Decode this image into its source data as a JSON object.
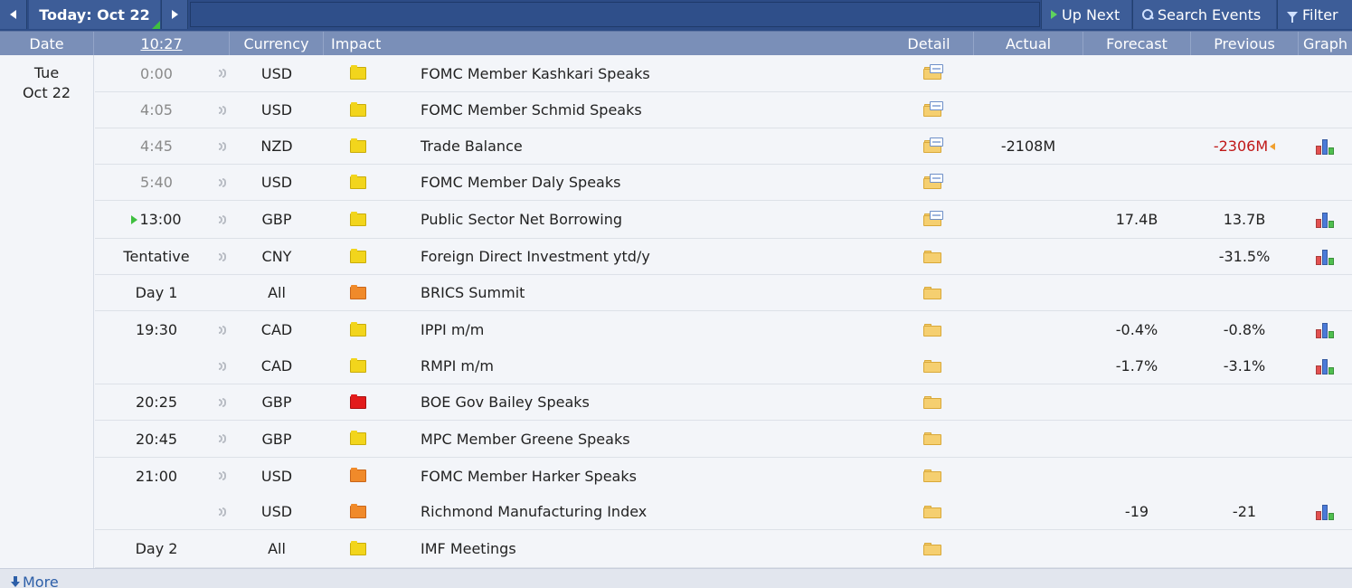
{
  "nav": {
    "today_label": "Today: Oct 22",
    "up_next": "Up Next",
    "search_events": "Search Events",
    "filter": "Filter"
  },
  "columns": {
    "date": "Date",
    "clock": "10:27",
    "currency": "Currency",
    "impact": "Impact",
    "detail": "Detail",
    "actual": "Actual",
    "forecast": "Forecast",
    "previous": "Previous",
    "graph": "Graph"
  },
  "day": {
    "weekday": "Tue",
    "date": "Oct 22"
  },
  "events": [
    {
      "time": "0:00",
      "currency": "USD",
      "impact": "low",
      "event": "FOMC Member Kashkari Speaks",
      "actual": "",
      "forecast": "",
      "previous": "",
      "graph": false
    },
    {
      "time": "4:05",
      "currency": "USD",
      "impact": "low",
      "event": "FOMC Member Schmid Speaks",
      "actual": "",
      "forecast": "",
      "previous": "",
      "graph": false
    },
    {
      "time": "4:45",
      "currency": "NZD",
      "impact": "low",
      "event": "Trade Balance",
      "actual": "-2108M",
      "forecast": "",
      "previous": "-2306M",
      "graph": true
    },
    {
      "time": "5:40",
      "currency": "USD",
      "impact": "low",
      "event": "FOMC Member Daly Speaks",
      "actual": "",
      "forecast": "",
      "previous": "",
      "graph": false
    },
    {
      "time": "13:00",
      "currency": "GBP",
      "impact": "low",
      "event": "Public Sector Net Borrowing",
      "actual": "",
      "forecast": "17.4B",
      "previous": "13.7B",
      "graph": true
    },
    {
      "time": "Tentative",
      "currency": "CNY",
      "impact": "low",
      "event": "Foreign Direct Investment ytd/y",
      "actual": "",
      "forecast": "",
      "previous": "-31.5%",
      "graph": true
    },
    {
      "time": "Day 1",
      "currency": "All",
      "impact": "medium",
      "event": "BRICS Summit",
      "actual": "",
      "forecast": "",
      "previous": "",
      "graph": false
    },
    {
      "time": "19:30",
      "currency": "CAD",
      "impact": "low",
      "event": "IPPI m/m",
      "actual": "",
      "forecast": "-0.4%",
      "previous": "-0.8%",
      "graph": true
    },
    {
      "time": "",
      "currency": "CAD",
      "impact": "low",
      "event": "RMPI m/m",
      "actual": "",
      "forecast": "-1.7%",
      "previous": "-3.1%",
      "graph": true
    },
    {
      "time": "20:25",
      "currency": "GBP",
      "impact": "high",
      "event": "BOE Gov Bailey Speaks",
      "actual": "",
      "forecast": "",
      "previous": "",
      "graph": false
    },
    {
      "time": "20:45",
      "currency": "GBP",
      "impact": "low",
      "event": "MPC Member Greene Speaks",
      "actual": "",
      "forecast": "",
      "previous": "",
      "graph": false
    },
    {
      "time": "21:00",
      "currency": "USD",
      "impact": "medium",
      "event": "FOMC Member Harker Speaks",
      "actual": "",
      "forecast": "",
      "previous": "",
      "graph": false
    },
    {
      "time": "",
      "currency": "USD",
      "impact": "medium",
      "event": "Richmond Manufacturing Index",
      "actual": "",
      "forecast": "-19",
      "previous": "-21",
      "graph": true
    },
    {
      "time": "Day 2",
      "currency": "All",
      "impact": "low",
      "event": "IMF Meetings",
      "actual": "",
      "forecast": "",
      "previous": "",
      "graph": false
    }
  ],
  "footer": {
    "more": "More"
  },
  "colors": {
    "nav_bg": "#2d4c86",
    "header_bg": "#7a8fb8",
    "negative": "#c01818",
    "impact_low": "#f2d51c",
    "impact_medium": "#f08a2a",
    "impact_high": "#e21b1b"
  }
}
